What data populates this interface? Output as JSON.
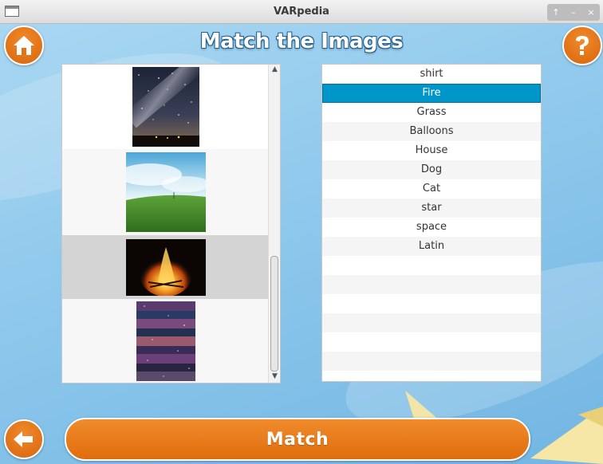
{
  "window": {
    "title": "VARpedia",
    "controls": [
      "↑",
      "–",
      "×"
    ]
  },
  "header": {
    "title": "Match the Images"
  },
  "icons": {
    "home": "home-icon",
    "help": "question-mark-icon",
    "back": "back-arrow-icon"
  },
  "image_list": {
    "items": [
      {
        "name": "starry-night-sky-thumbnail"
      },
      {
        "name": "green-grass-hill-thumbnail"
      },
      {
        "name": "bonfire-thumbnail"
      },
      {
        "name": "galaxy-space-collage-thumbnail"
      }
    ],
    "selected_index": 2
  },
  "word_list": {
    "items": [
      "shirt",
      "Fire",
      "Grass",
      "Balloons",
      "House",
      "Dog",
      "Cat",
      "star",
      "space",
      "Latin"
    ],
    "selected_index": 1
  },
  "bottom": {
    "match_label": "Match"
  },
  "colors": {
    "accent_orange": "#e87a1a",
    "selection_blue": "#0096c9",
    "background_blue": "#8ec8ec"
  }
}
